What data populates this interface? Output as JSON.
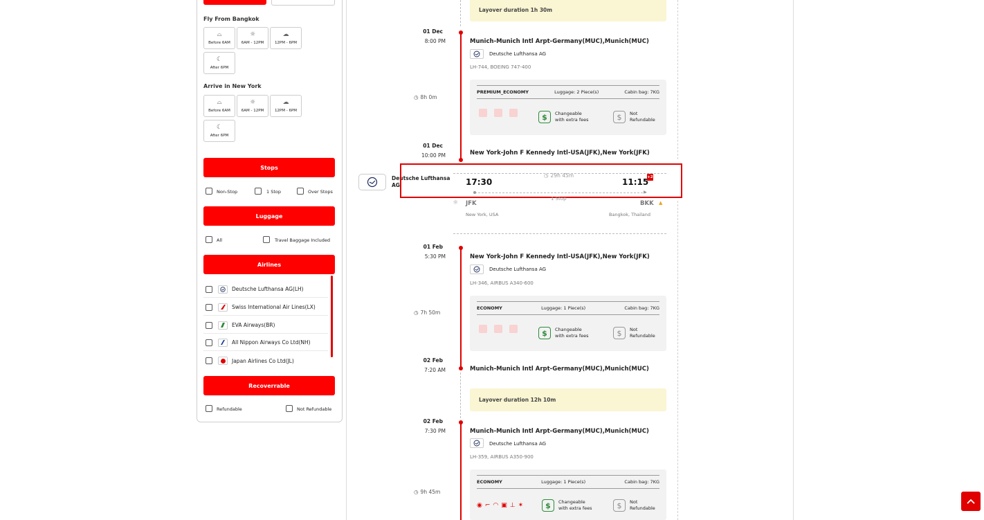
{
  "filters": {
    "fly_from_title": "Fly From Bangkok",
    "arrive_title": "Arrive in New York",
    "time_slots": [
      "Before 6AM",
      "6AM - 12PM",
      "12PM - 6PM",
      "After 6PM"
    ],
    "stops_label": "Stops",
    "stops_options": [
      "Non-Stop",
      "1 Stop",
      "Over Stops"
    ],
    "luggage_label": "Luggage",
    "luggage_options": [
      "All",
      "Travel Baggage Included"
    ],
    "airlines_label": "Airlines",
    "airlines": [
      {
        "name": "Deutsche Lufthansa AG(LH)",
        "logo_color": "#1b2a5a",
        "icon": "crane-icon"
      },
      {
        "name": "Swiss International Air Lines(LX)",
        "logo_color": "#e00000",
        "icon": "swiss-icon"
      },
      {
        "name": "EVA Airways(BR)",
        "logo_color": "#2e8b3a",
        "icon": "eva-icon"
      },
      {
        "name": "All Nippon Airways Co Ltd(NH)",
        "logo_color": "#1a3c9c",
        "icon": "ana-icon"
      },
      {
        "name": "Japan Airlines Co Ltd(JL)",
        "logo_color": "#e00000",
        "icon": "jal-icon"
      }
    ],
    "recoverable_label": "Recoverrable",
    "recoverable_options": [
      "Refundable",
      "Not Refundable"
    ]
  },
  "itinerary": {
    "layover_top": "Layover duration 1h 30m",
    "seg1": {
      "dep_date": "01 Dec",
      "dep_time": "8:00 PM",
      "dep_airport": "Munich-Munich Intl Arpt-Germany(MUC),Munich(MUC)",
      "carrier": "Deutsche Lufthansa AG",
      "flight": "LH-744, BOEING 747-400",
      "duration": "8h 0m",
      "cabin_class": "PREMIUM_ECONOMY",
      "luggage": "Luggage: 2 Piece(s)",
      "cabin_bag": "Cabin bag: 7KG",
      "changeable_1": "Changeable",
      "changeable_2": "with extra fees",
      "refund_1": "Not",
      "refund_2": "Refundable",
      "arr_date": "01 Dec",
      "arr_time": "10:00 PM",
      "arr_airport": "New York-John F Kennedy Intl-USA(JFK),New York(JFK)"
    },
    "summary": {
      "airline": "Deutsche Lufthansa AG",
      "dep_time": "17:30",
      "total_duration": "29h 45m",
      "arr_time": "11:15",
      "day_offset": "+2",
      "stops": "1 Stop",
      "from_code": "JFK",
      "from_city": "New York, USA",
      "to_code": "BKK",
      "to_city": "Bangkok, Thailand"
    },
    "seg2": {
      "dep_date": "01 Feb",
      "dep_time": "5:30 PM",
      "dep_airport": "New York-John F Kennedy Intl-USA(JFK),New York(JFK)",
      "carrier": "Deutsche Lufthansa AG",
      "flight": "LH-346, AIRBUS A340-600",
      "duration": "7h 50m",
      "cabin_class": "ECONOMY",
      "luggage": "Luggage: 1 Piece(s)",
      "cabin_bag": "Cabin bag: 7KG",
      "changeable_1": "Changeable",
      "changeable_2": "with extra fees",
      "refund_1": "Not",
      "refund_2": "Refundable",
      "arr_date": "02 Feb",
      "arr_time": "7:20 AM",
      "arr_airport": "Munich-Munich Intl Arpt-Germany(MUC),Munich(MUC)"
    },
    "layover_mid": "Layover duration 12h 10m",
    "seg3": {
      "dep_date": "02 Feb",
      "dep_time": "7:30 PM",
      "dep_airport": "Munich-Munich Intl Arpt-Germany(MUC),Munich(MUC)",
      "carrier": "Deutsche Lufthansa AG",
      "flight": "LH-359, AIRBUS A350-900",
      "duration": "9h 45m",
      "cabin_class": "ECONOMY",
      "luggage": "Luggage: 1 Piece(s)",
      "cabin_bag": "Cabin bag: 7KG",
      "changeable_1": "Changeable",
      "changeable_2": "with extra fees",
      "refund_1": "Not",
      "refund_2": "Refundable"
    }
  },
  "colors": {
    "accent": "#ff0000",
    "layover_bg": "#faf5d2",
    "card_bg": "#f2f2f2",
    "change_green": "#2e8b3a"
  }
}
